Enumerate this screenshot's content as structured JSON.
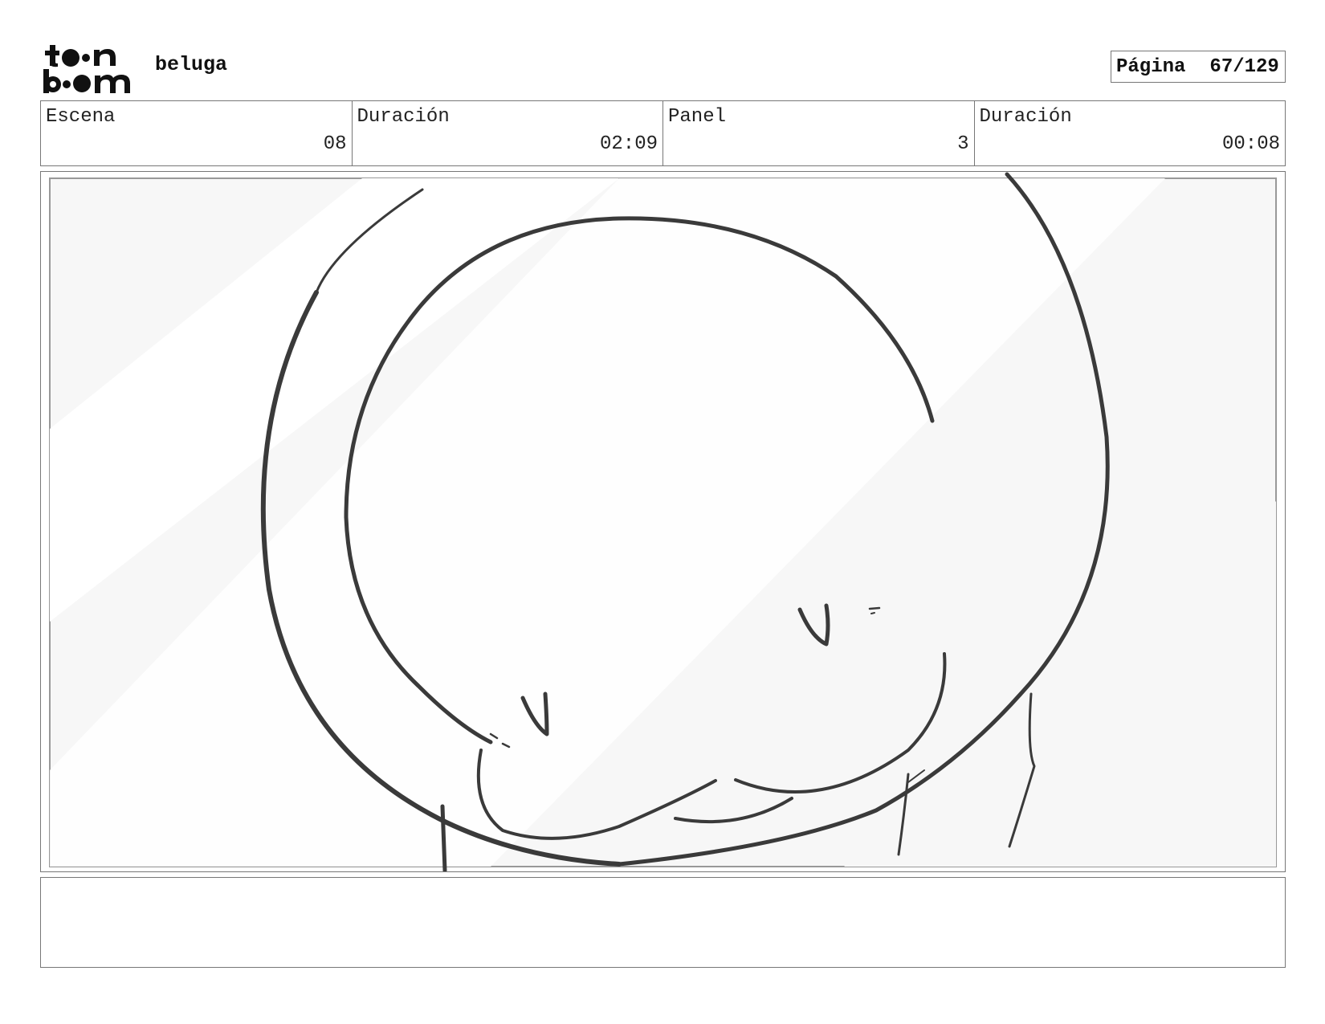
{
  "header": {
    "logo_alt": "toon boom",
    "project_title": "beluga",
    "page_label": "Página",
    "page_value": "67/129"
  },
  "info": {
    "scene_label": "Escena",
    "scene_value": "08",
    "scene_duration_label": "Duración",
    "scene_duration_value": "02:09",
    "panel_label": "Panel",
    "panel_value": "3",
    "panel_duration_label": "Duración",
    "panel_duration_value": "00:08"
  },
  "notes": {
    "text": ""
  },
  "colors": {
    "frame_border": "#777777",
    "sketch_line": "#3a3a3a",
    "panel_bg": "#f7f7f7"
  }
}
